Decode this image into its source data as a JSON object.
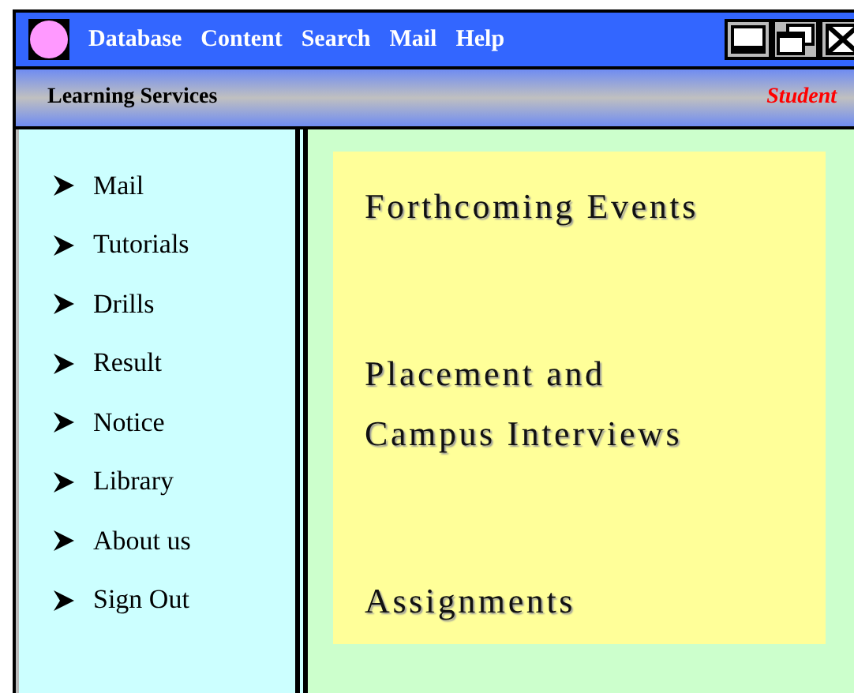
{
  "menu": [
    "Database",
    "Content",
    "Search",
    "Mail",
    "Help"
  ],
  "header": {
    "title": "Learning Services",
    "role": "Student"
  },
  "sidebar": {
    "items": [
      "Mail",
      "Tutorials",
      "Drills",
      "Result",
      "Notice",
      "Library",
      "About us",
      "Sign Out"
    ]
  },
  "content": {
    "sections": [
      [
        "Forthcoming Events"
      ],
      [
        "Placement and",
        "Campus Interviews"
      ],
      [
        "Assignments"
      ]
    ]
  }
}
